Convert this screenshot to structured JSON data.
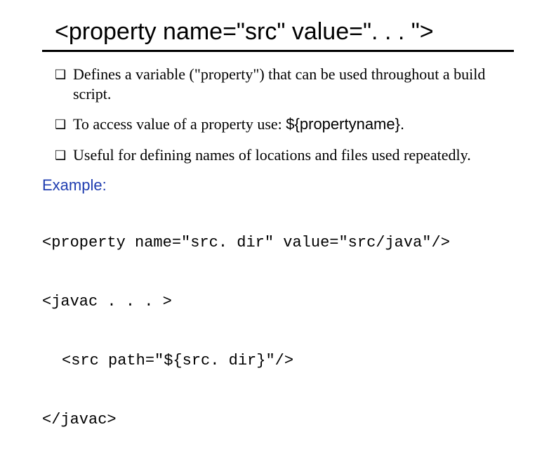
{
  "title": "<property name=\"src\" value=\". . . \">",
  "bullets": [
    {
      "text": "Defines a variable (\"property\")  that can be used throughout a build script."
    },
    {
      "text_prefix": "To access value of a property use:  ",
      "text_code": "${propertyname}.",
      "has_code": true
    },
    {
      "text": "Useful for defining names of locations and files used repeatedly."
    }
  ],
  "example_label": "Example:",
  "code": {
    "line1": "<property name=\"src. dir\" value=\"src/java\"/>",
    "line2": "<javac . . . >",
    "line3": "<src path=\"${src. dir}\"/>",
    "line4": "</javac>"
  }
}
